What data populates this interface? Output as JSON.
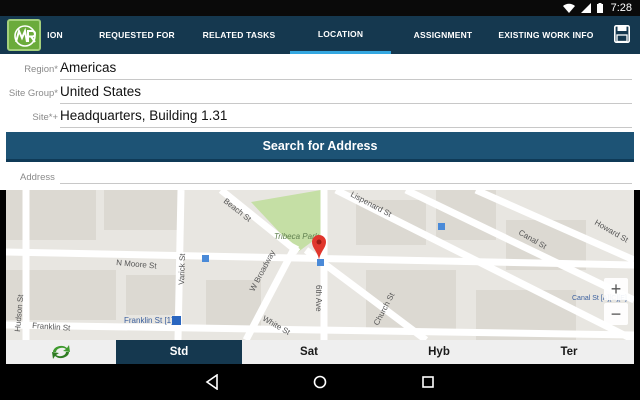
{
  "status_bar": {
    "time": "7:28",
    "icons": [
      "wifi-icon",
      "signal-icon",
      "battery-icon"
    ]
  },
  "header": {
    "tabs": [
      {
        "label": "ION",
        "active": false
      },
      {
        "label": "REQUESTED FOR",
        "active": false
      },
      {
        "label": "RELATED TASKS",
        "active": false
      },
      {
        "label": "LOCATION",
        "active": true
      },
      {
        "label": "ASSIGNMENT",
        "active": false
      },
      {
        "label": "EXISTING WORK INFO",
        "active": false
      }
    ],
    "save_icon": "floppy-disk-icon"
  },
  "form": {
    "region": {
      "label": "Region*",
      "value": "Americas"
    },
    "site_group": {
      "label": "Site Group*",
      "value": "United States"
    },
    "site": {
      "label": "Site*+",
      "value": "Headquarters, Building 1.31"
    },
    "search_button": "Search for Address",
    "address": {
      "label": "Address",
      "value": ""
    }
  },
  "map": {
    "streets": [
      "Beach St",
      "N Moore St",
      "Varick St",
      "W Broadway",
      "White St",
      "Hudson St",
      "Franklin St",
      "Church St",
      "6th Ave",
      "Lispenard St",
      "Canal St",
      "Howard St"
    ],
    "places": [
      "Tribeca Park",
      "Franklin St [1]",
      "Canal St [A][C][E]"
    ],
    "zoom_in": "+",
    "zoom_out": "−"
  },
  "map_types": [
    {
      "label": "Std",
      "active": true
    },
    {
      "label": "Sat",
      "active": false
    },
    {
      "label": "Hyb",
      "active": false
    },
    {
      "label": "Ter",
      "active": false
    }
  ],
  "colors": {
    "header": "#15384f",
    "active_tab_underline": "#34a7e0",
    "search_button": "#1d5375",
    "logo_green": "#6bab3b",
    "map_park": "#c5dfa5",
    "pin": "#e0362c"
  }
}
